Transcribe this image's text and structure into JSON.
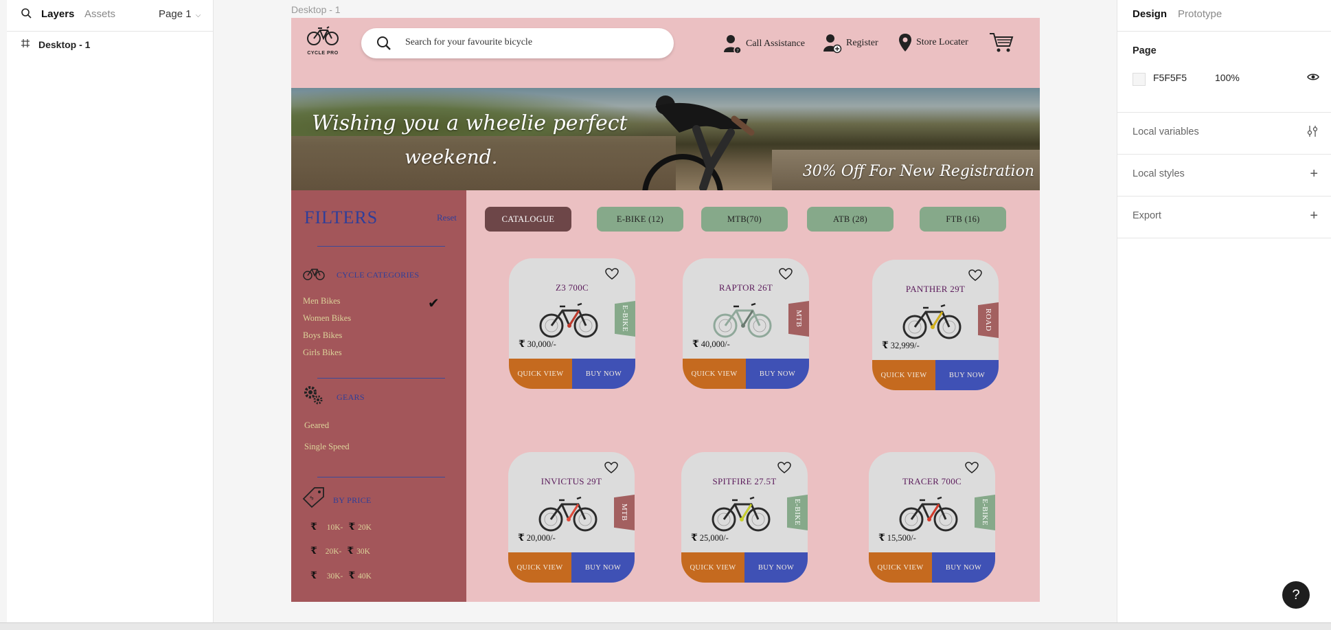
{
  "left_panel": {
    "tabs": [
      "Layers",
      "Assets"
    ],
    "page_selector": "Page 1",
    "layers": [
      {
        "label": "Desktop - 1"
      }
    ]
  },
  "canvas": {
    "frame_label": "Desktop - 1",
    "header": {
      "logo_text": "CYCLE PRO",
      "search_placeholder": "Search for your favourite bicycle",
      "nav": [
        {
          "label": "Call Assistance",
          "icon": "support-agent-icon"
        },
        {
          "label": "Register",
          "icon": "add-user-icon"
        },
        {
          "label": "Store Locater",
          "icon": "location-pin-icon"
        },
        {
          "label": "",
          "icon": "cart-icon"
        }
      ]
    },
    "banner": {
      "line1": "Wishing you a wheelie perfect",
      "line2": "weekend.",
      "offer": "30% Off For New Registration"
    },
    "filters": {
      "title": "FILTERS",
      "reset": "Reset",
      "categories_title": "CYCLE CATEGORIES",
      "categories": [
        "Men Bikes",
        "Women Bikes",
        "Boys Bikes",
        "Girls Bikes"
      ],
      "categories_checked": "Men Bikes",
      "gears_title": "GEARS",
      "gears": [
        "Geared",
        "Single Speed"
      ],
      "price_title": "BY PRICE",
      "price_ranges": [
        {
          "from": "10K-",
          "to": "20K"
        },
        {
          "from": "20K-",
          "to": "30K"
        },
        {
          "from": "30K-",
          "to": "40K"
        }
      ]
    },
    "category_buttons": [
      "CATALOGUE",
      "E-BIKE (12)",
      "MTB(70)",
      "ATB (28)",
      "FTB (16)"
    ],
    "products": [
      {
        "name": "Z3 700C",
        "price": "30,000/-",
        "tag": "E-BIKE",
        "tag_color": "#86a98a",
        "frame_color": "#2b2b2b",
        "accent": "#c0392b"
      },
      {
        "name": "RAPTOR 26T",
        "price": "40,000/-",
        "tag": "MTB",
        "tag_color": "#a36060",
        "frame_color": "#8fa89a",
        "accent": "#6a7a70"
      },
      {
        "name": "PANTHER 29T",
        "price": "32,999/-",
        "tag": "ROAD",
        "tag_color": "#a36060",
        "frame_color": "#2b2b2b",
        "accent": "#d4b21a"
      },
      {
        "name": "INVICTUS 29T",
        "price": "20,000/-",
        "tag": "MTB",
        "tag_color": "#a36060",
        "frame_color": "#2b2b2b",
        "accent": "#e04a3a"
      },
      {
        "name": "SPITFIRE 27.5T",
        "price": "25,000/-",
        "tag": "E-BIKE",
        "tag_color": "#86a98a",
        "frame_color": "#2b2b2b",
        "accent": "#c9d12a"
      },
      {
        "name": "TRACER 700C",
        "price": "15,500/-",
        "tag": "E-BIKE",
        "tag_color": "#86a98a",
        "frame_color": "#2b2b2b",
        "accent": "#d63a2a"
      }
    ],
    "quick_view_label": "QUICK VIEW",
    "buy_now_label": "BUY NOW",
    "rupee_symbol": "₹"
  },
  "right_panel": {
    "tabs": [
      "Design",
      "Prototype"
    ],
    "page_section": {
      "title": "Page",
      "color_hex": "F5F5F5",
      "opacity": "100%"
    },
    "sections": [
      "Local variables",
      "Local styles",
      "Export"
    ]
  },
  "help_label": "?"
}
